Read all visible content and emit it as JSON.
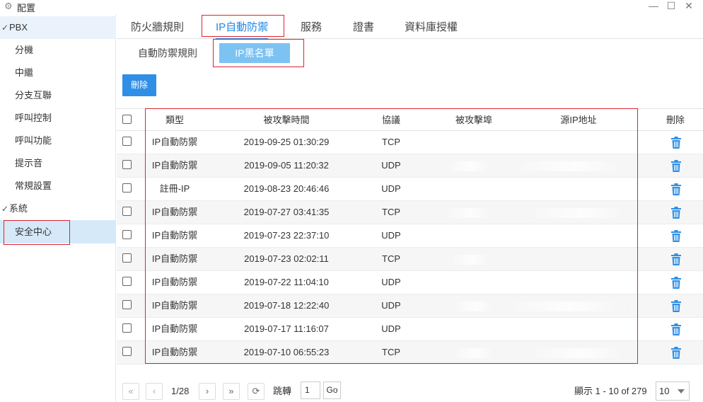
{
  "window": {
    "title": "配置",
    "icon": "gear-icon",
    "controls": [
      "—",
      "☐",
      "✕"
    ]
  },
  "sidebar": {
    "groups": [
      {
        "label": "PBX",
        "items": [
          "分機",
          "中繼",
          "分支互聯",
          "呼叫控制",
          "呼叫功能",
          "提示音",
          "常規設置"
        ]
      },
      {
        "label": "系統",
        "items": [
          "安全中心"
        ]
      }
    ],
    "active_item": "安全中心"
  },
  "tabs": [
    "防火牆規則",
    "IP自動防禦",
    "服務",
    "證書",
    "資料庫授權"
  ],
  "active_tab": "IP自動防禦",
  "subtabs": [
    "自動防禦規則",
    "IP黑名單"
  ],
  "active_subtab": "IP黑名單",
  "toolbar": {
    "delete_label": "刪除"
  },
  "table": {
    "headers": {
      "type": "類型",
      "time": "被攻擊時間",
      "protocol": "協議",
      "port": "被攻擊埠",
      "source_ip": "源IP地址",
      "delete": "刪除"
    },
    "rows": [
      {
        "type": "IP自動防禦",
        "time": "2019-09-25 01:30:29",
        "protocol": "TCP"
      },
      {
        "type": "IP自動防禦",
        "time": "2019-09-05 11:20:32",
        "protocol": "UDP"
      },
      {
        "type": "註冊-IP",
        "time": "2019-08-23 20:46:46",
        "protocol": "UDP"
      },
      {
        "type": "IP自動防禦",
        "time": "2019-07-27 03:41:35",
        "protocol": "TCP"
      },
      {
        "type": "IP自動防禦",
        "time": "2019-07-23 22:37:10",
        "protocol": "UDP"
      },
      {
        "type": "IP自動防禦",
        "time": "2019-07-23 02:02:11",
        "protocol": "TCP"
      },
      {
        "type": "IP自動防禦",
        "time": "2019-07-22 11:04:10",
        "protocol": "UDP"
      },
      {
        "type": "IP自動防禦",
        "time": "2019-07-18 12:22:40",
        "protocol": "UDP"
      },
      {
        "type": "IP自動防禦",
        "time": "2019-07-17 11:16:07",
        "protocol": "UDP"
      },
      {
        "type": "IP自動防禦",
        "time": "2019-07-10 06:55:23",
        "protocol": "TCP"
      }
    ]
  },
  "pagination": {
    "page_display": "1/28",
    "jump_label": "跳轉",
    "jump_value": "1",
    "go_label": "Go",
    "summary": "顯示 1 - 10 of 279",
    "page_size": "10"
  },
  "colors": {
    "accent": "#1e88e5",
    "highlight_box": "#d9252f",
    "delete_button": "#2f8fe6",
    "trash_icon": "#2f8fe6"
  }
}
